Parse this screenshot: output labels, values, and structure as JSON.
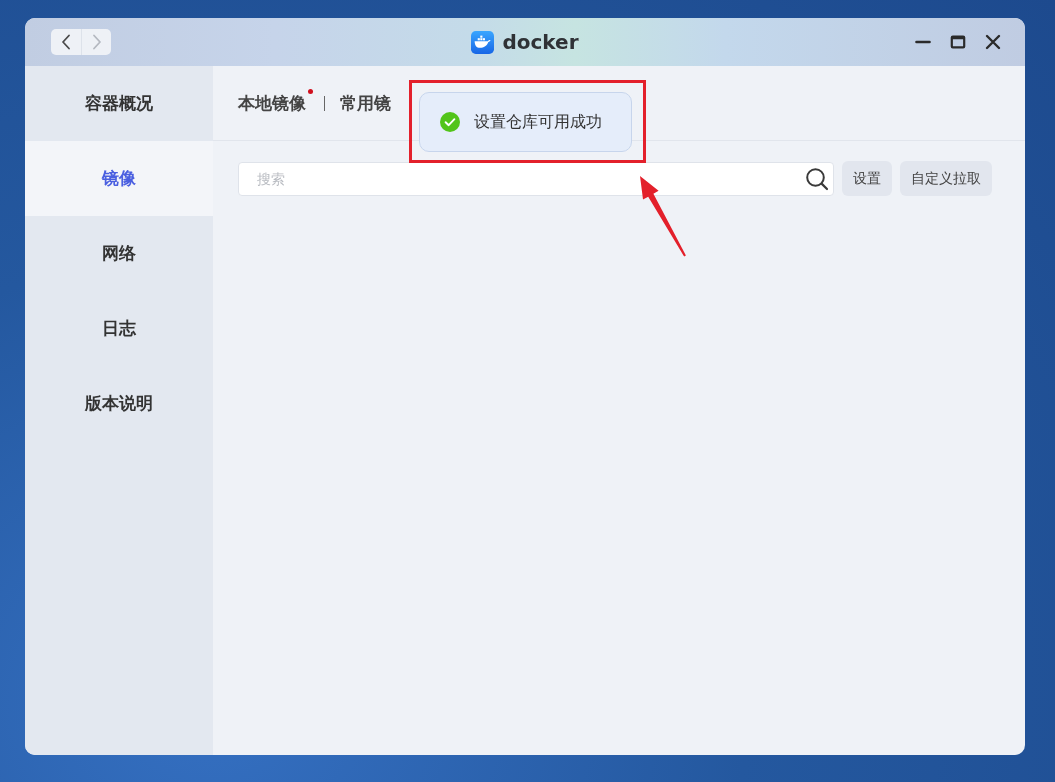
{
  "window": {
    "title": "docker"
  },
  "nav_buttons": [
    {
      "kind": "back",
      "disabled": false
    },
    {
      "kind": "forward",
      "disabled": true
    }
  ],
  "sidebar": {
    "items": [
      {
        "label": "容器概况",
        "selected": false
      },
      {
        "label": "镜像",
        "selected": true
      },
      {
        "label": "网络",
        "selected": false
      },
      {
        "label": "日志",
        "selected": false
      },
      {
        "label": "版本说明",
        "selected": false
      }
    ]
  },
  "tabs": [
    {
      "label": "本地镜像",
      "dot": true
    },
    {
      "label": "常用镜",
      "dot": false
    }
  ],
  "search": {
    "placeholder": "搜索"
  },
  "buttons": [
    "设置",
    "自定义拉取"
  ],
  "toast": {
    "kind": "success",
    "message": "设置仓库可用成功"
  }
}
